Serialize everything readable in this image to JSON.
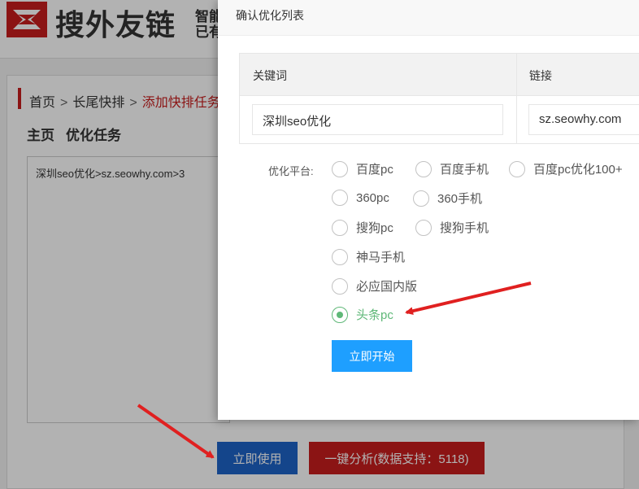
{
  "header": {
    "brand": "搜外友链",
    "tagline_line1": "智能",
    "tagline_line2": "已有"
  },
  "breadcrumb": {
    "home": "首页",
    "parent": "长尾快排",
    "current": "添加快排任务",
    "separator": ">"
  },
  "page": {
    "subtitle_home": "主页",
    "subtitle_task": "优化任务",
    "task_text": "深圳seo优化>sz.seowhy.com>3"
  },
  "actions": {
    "use_now": "立即使用",
    "analyze": "一键分析(数据支持：5118)"
  },
  "modal": {
    "title": "确认优化列表",
    "table": {
      "col_keyword": "关键词",
      "col_link": "链接",
      "keyword_value": "深圳seo优化",
      "link_value": "sz.seowhy.com"
    },
    "platform_label": "优化平台:",
    "platforms": [
      {
        "label": "百度pc",
        "checked": false
      },
      {
        "label": "百度手机",
        "checked": false
      },
      {
        "label": "百度pc优化100+",
        "checked": false
      },
      {
        "label": "360pc",
        "checked": false
      },
      {
        "label": "360手机",
        "checked": false
      },
      {
        "label": "搜狗pc",
        "checked": false
      },
      {
        "label": "搜狗手机",
        "checked": false
      },
      {
        "label": "神马手机",
        "checked": false
      },
      {
        "label": "必应国内版",
        "checked": false
      },
      {
        "label": "头条pc",
        "checked": true
      }
    ],
    "start_button": "立即开始"
  },
  "colors": {
    "brand_red": "#c81e1e",
    "primary_blue": "#1e9fff",
    "use_button_blue": "#1e63c8",
    "radio_green": "#5fb878",
    "arrow_red": "#e02020"
  }
}
